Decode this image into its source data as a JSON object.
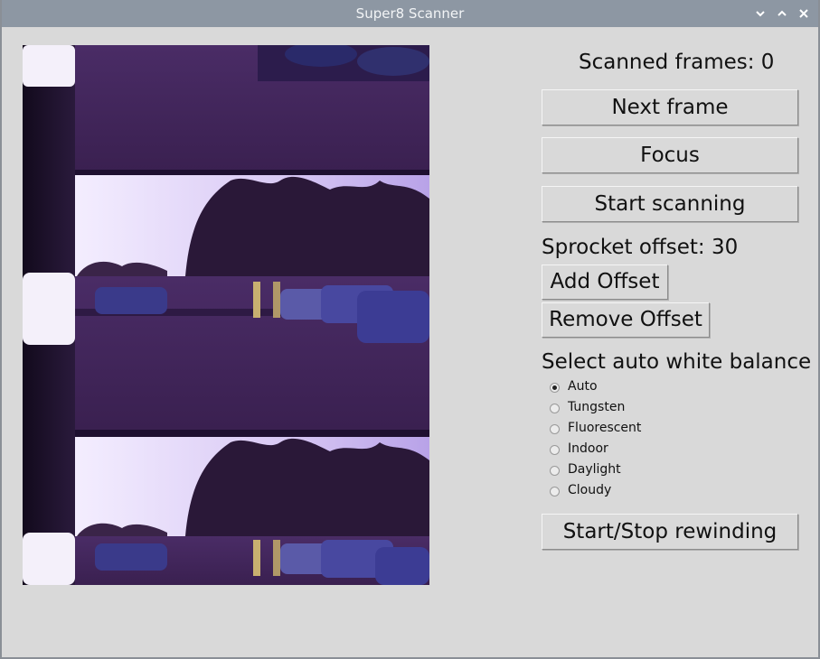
{
  "window": {
    "title": "Super8 Scanner"
  },
  "status": {
    "scanned_frames": "Scanned frames: 0",
    "sprocket_offset": "Sprocket offset: 30"
  },
  "buttons": {
    "next_frame": "Next frame",
    "focus": "Focus",
    "start_scanning": "Start scanning",
    "add_offset": "Add Offset",
    "remove_offset": "Remove Offset",
    "start_stop_rewinding": "Start/Stop rewinding"
  },
  "white_balance": {
    "heading": "Select auto white balance",
    "selected": "Auto",
    "options": [
      "Auto",
      "Tungsten",
      "Fluorescent",
      "Indoor",
      "Daylight",
      "Cloudy"
    ]
  },
  "icons": {
    "minimize": "chevron-down-icon",
    "maximize": "chevron-up-icon",
    "close": "close-icon"
  },
  "colors": {
    "titlebar": "#8d97a3",
    "window_bg": "#d9d9d9",
    "film_tint": "#4a2a6a"
  }
}
